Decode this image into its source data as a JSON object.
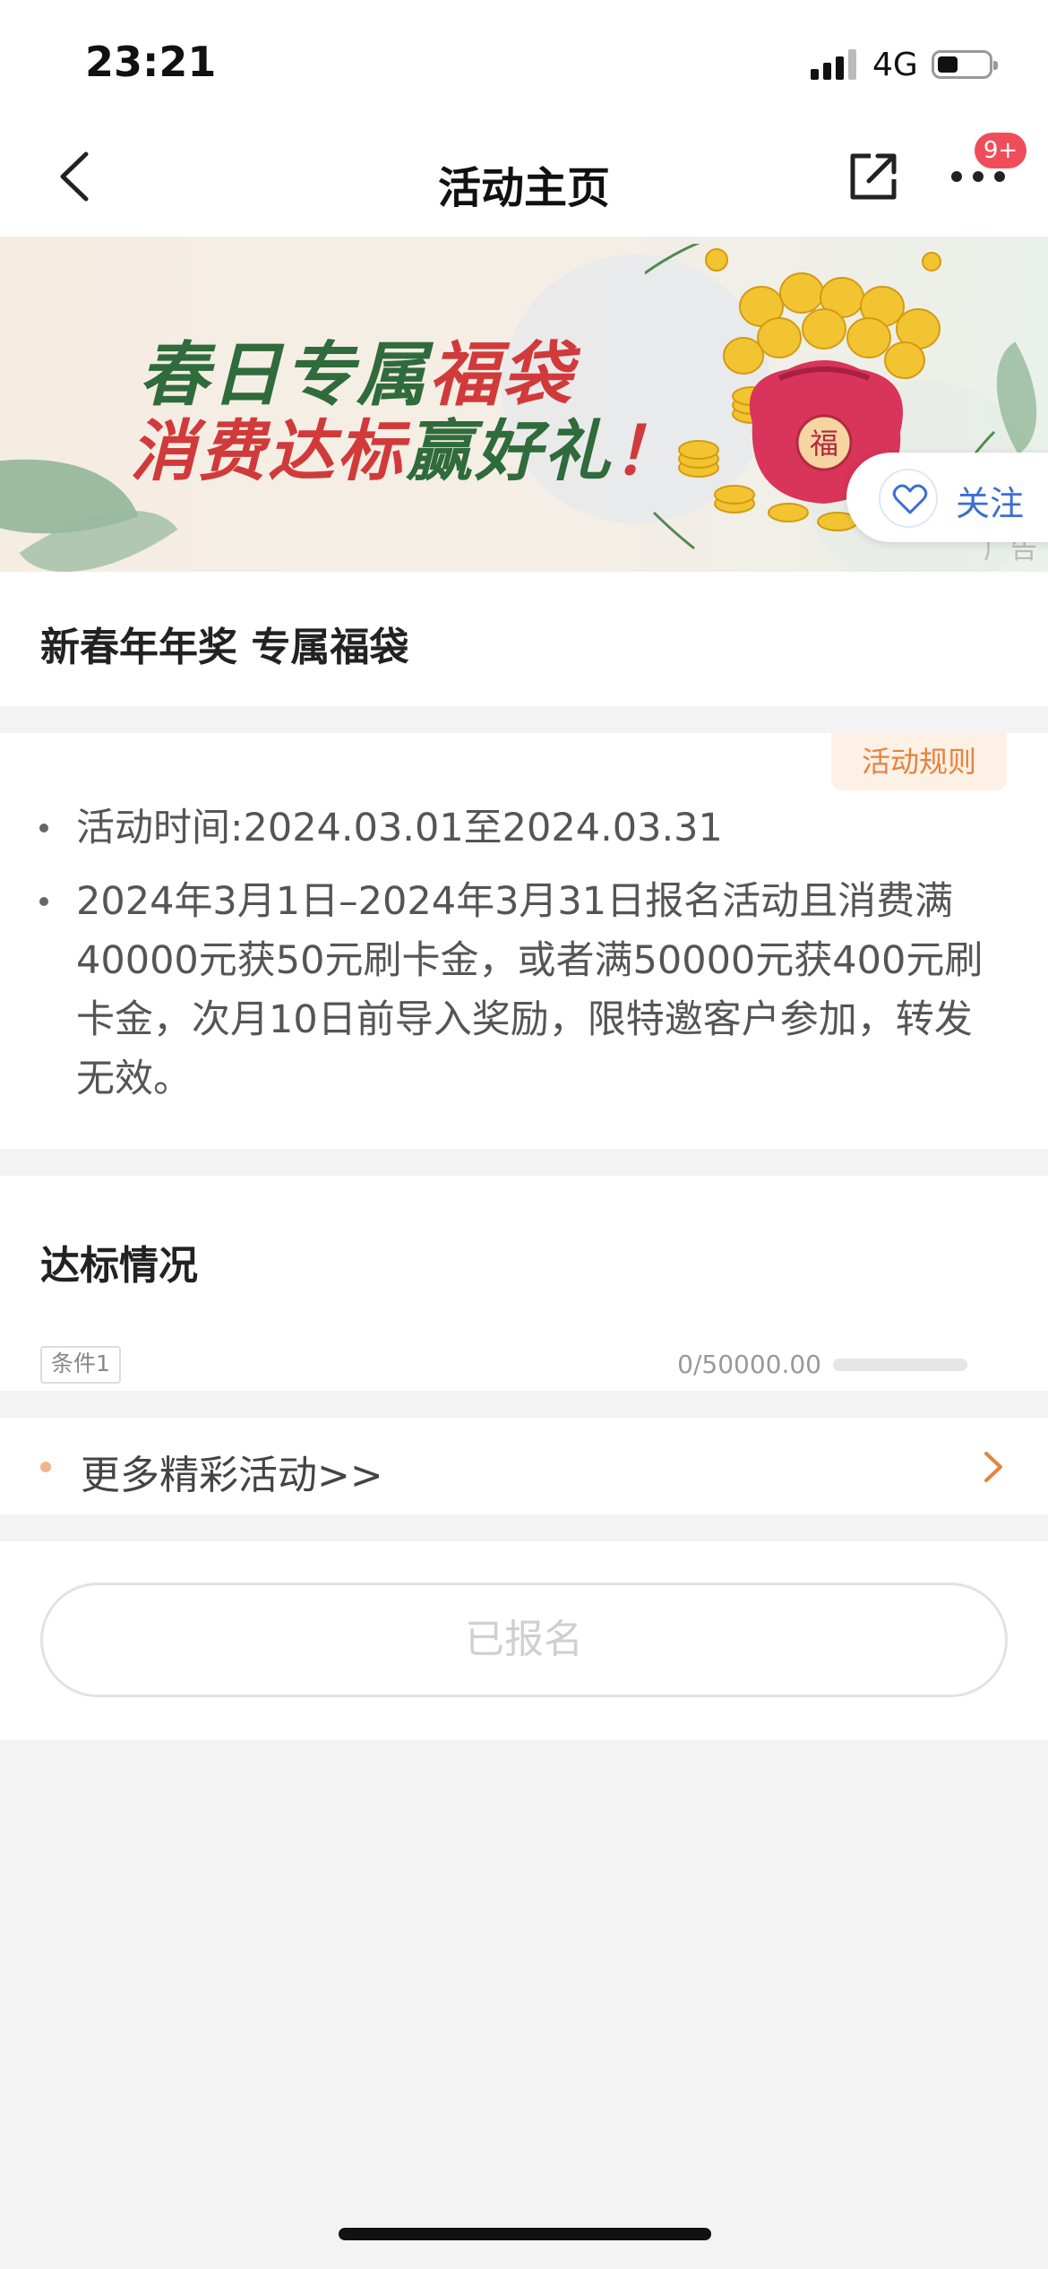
{
  "status_bar": {
    "time": "23:21",
    "network": "4G"
  },
  "nav": {
    "title": "活动主页",
    "badge": "9+"
  },
  "banner": {
    "line1_green": "春日专属",
    "line1_red": "福袋",
    "line2_red": "消费达标",
    "line2_green": "赢好礼",
    "line2_end": "！",
    "bag_char": "福",
    "ad_label": "广告"
  },
  "follow": {
    "label": "关注"
  },
  "activity": {
    "title": "新春年年奖 专属福袋"
  },
  "rules": {
    "tag": "活动规则",
    "items": [
      "活动时间:2024.03.01至2024.03.31",
      "2024年3月1日–2024年3月31日报名活动且消费满",
      "40000元获50元刷卡金，或者满50000元获400元刷",
      "卡金，次月10日前导入奖励，限特邀客户参加，转发",
      "无效。"
    ]
  },
  "progress": {
    "title": "达标情况",
    "condition_label": "条件1",
    "value_text": "0/50000.00",
    "current": 0,
    "target": 50000
  },
  "more": {
    "label": "更多精彩活动>>"
  },
  "signup": {
    "label": "已报名"
  },
  "colors": {
    "accent": "#e5833d",
    "follow_blue": "#3b6fd1",
    "badge_red": "#f04d5b"
  }
}
